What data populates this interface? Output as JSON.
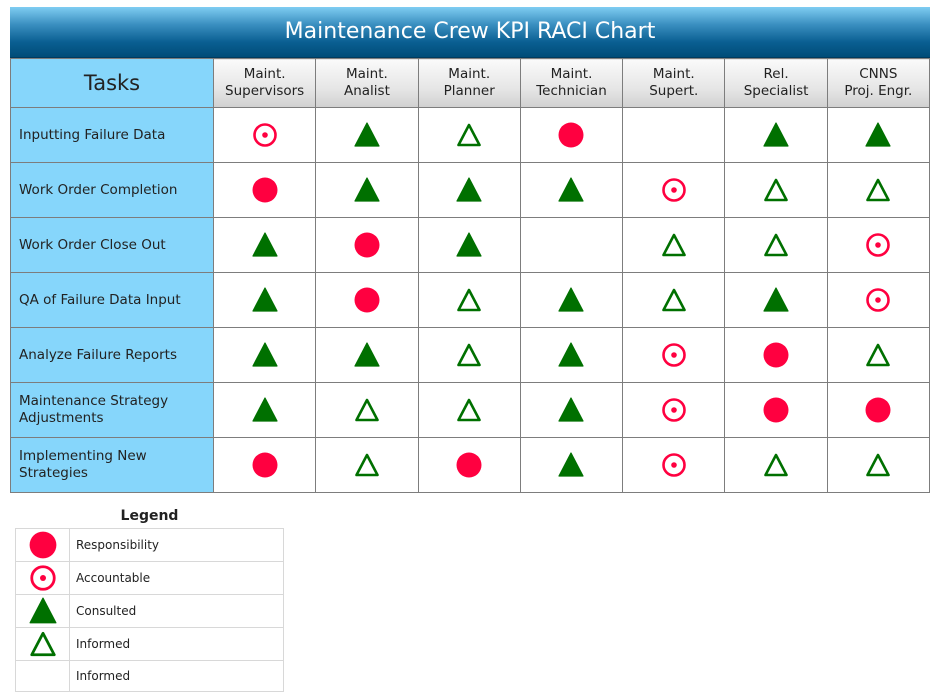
{
  "chart_data": {
    "type": "table",
    "title": "Maintenance Crew KPI RACI Chart",
    "corner_header": "Tasks",
    "columns": [
      [
        "Maint.",
        "Supervisors"
      ],
      [
        "Maint.",
        "Analist"
      ],
      [
        "Maint.",
        "Planner"
      ],
      [
        "Maint.",
        "Technician"
      ],
      [
        "Maint.",
        "Supert."
      ],
      [
        "Rel.",
        "Specialist"
      ],
      [
        "CNNS",
        "Proj. Engr."
      ]
    ],
    "rows": [
      {
        "task": [
          "Inputting Failure Data"
        ],
        "cells": [
          "A",
          "C",
          "I",
          "R",
          "",
          "C",
          "C"
        ]
      },
      {
        "task": [
          "Work Order Completion"
        ],
        "cells": [
          "R",
          "C",
          "C",
          "C",
          "A",
          "I",
          "I"
        ]
      },
      {
        "task": [
          "Work Order Close Out"
        ],
        "cells": [
          "C",
          "R",
          "C",
          "",
          "I",
          "I",
          "A"
        ]
      },
      {
        "task": [
          "QA of Failure Data Input"
        ],
        "cells": [
          "C",
          "R",
          "I",
          "C",
          "I",
          "C",
          "A"
        ]
      },
      {
        "task": [
          "Analyze Failure Reports"
        ],
        "cells": [
          "C",
          "C",
          "I",
          "C",
          "A",
          "R",
          "I"
        ]
      },
      {
        "task": [
          "Maintenance Strategy",
          "Adjustments"
        ],
        "cells": [
          "C",
          "I",
          "I",
          "C",
          "A",
          "R",
          "R"
        ]
      },
      {
        "task": [
          "Implementing New",
          "Strategies"
        ],
        "cells": [
          "R",
          "I",
          "R",
          "C",
          "A",
          "I",
          "I"
        ]
      }
    ],
    "legend": {
      "title": "Legend",
      "entries": [
        {
          "code": "R",
          "label": "Responsibility",
          "icon": "filled-circle"
        },
        {
          "code": "A",
          "label": "Accountable",
          "icon": "dotted-ring"
        },
        {
          "code": "C",
          "label": "Consulted",
          "icon": "filled-triangle"
        },
        {
          "code": "I",
          "label": "Informed",
          "icon": "outline-triangle"
        },
        {
          "code": "",
          "label": "Informed",
          "icon": "none"
        }
      ]
    },
    "colors": {
      "responsible": "#ff0040",
      "accountable": "#ff0040",
      "consulted": "#007000",
      "informed": "#007000",
      "tasks_bg": "#86d6fb",
      "title_bg": "#0a5f92"
    }
  }
}
